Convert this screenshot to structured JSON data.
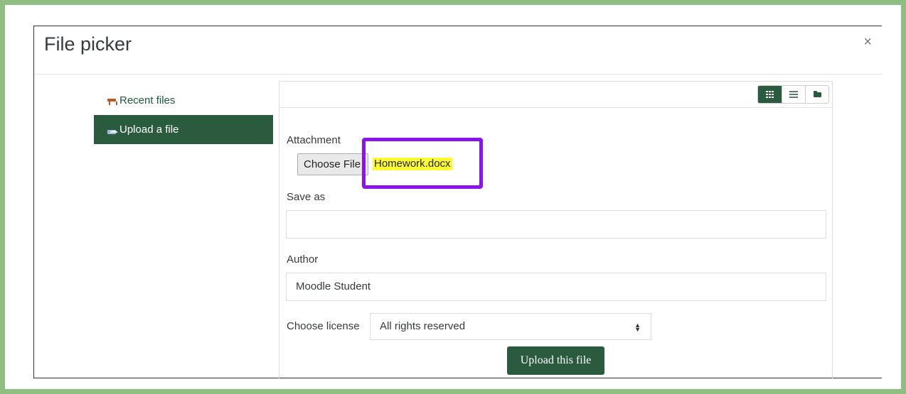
{
  "dialog": {
    "title": "File picker",
    "close_symbol": "×"
  },
  "sidebar": {
    "items": [
      {
        "label": "Recent files",
        "icon": "recent-files-icon",
        "active": false
      },
      {
        "label": "Upload a file",
        "icon": "upload-icon",
        "active": true
      }
    ]
  },
  "toolbar": {
    "view_icons": [
      "grid-view-icon",
      "list-view-icon",
      "folder-view-icon"
    ],
    "active_view": "grid-view-icon"
  },
  "form": {
    "attachment_label": "Attachment",
    "choose_file_label": "Choose File",
    "file_name": "Homework.docx",
    "save_as_label": "Save as",
    "save_as_value": "",
    "author_label": "Author",
    "author_value": "Moodle Student",
    "license_label": "Choose license",
    "license_value": "All rights reserved",
    "upload_label": "Upload this file"
  },
  "colors": {
    "frame": "#8fbf80",
    "accent": "#2a5b3f",
    "highlight_box": "#8a14f0",
    "text_highlight": "#fdfd30"
  }
}
